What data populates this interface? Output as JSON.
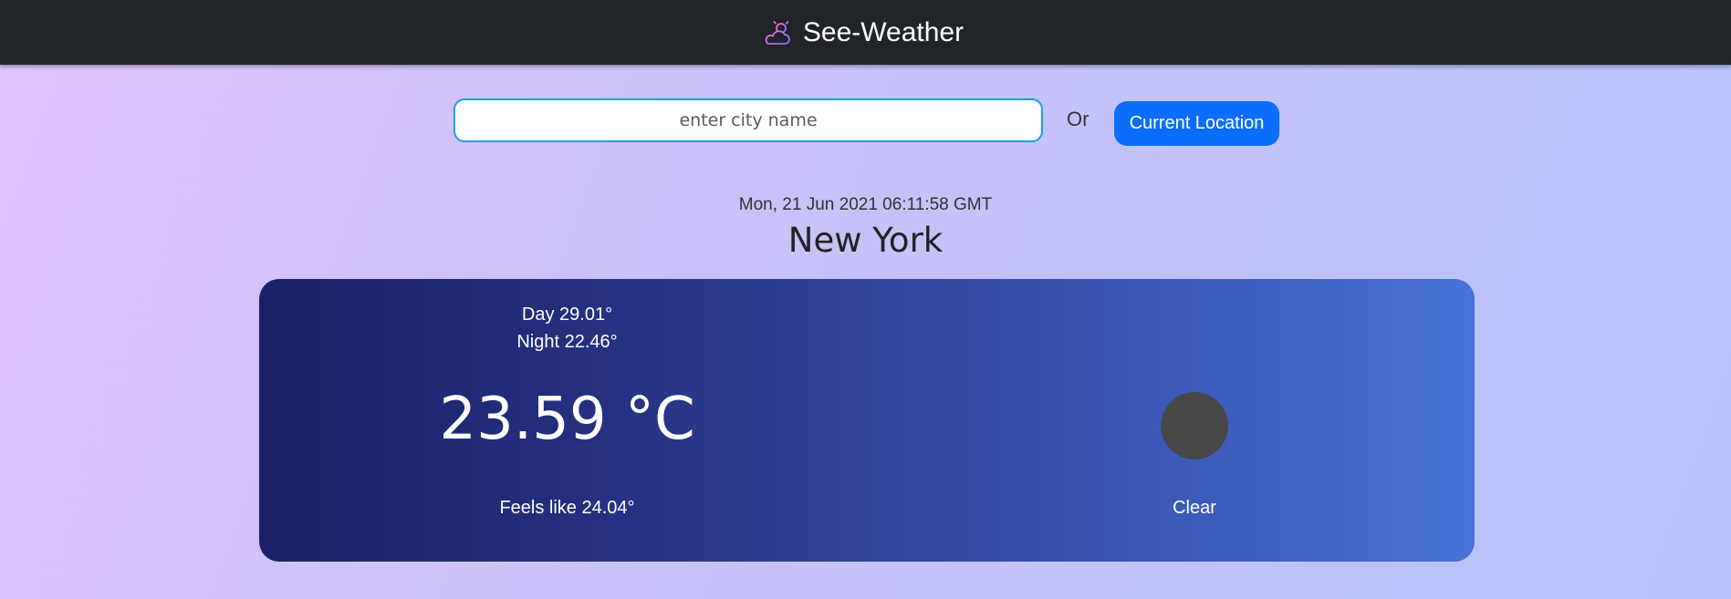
{
  "app": {
    "title": "See-Weather",
    "icon": "partly-cloudy-sun-icon"
  },
  "search": {
    "placeholder": "enter city name",
    "value": "",
    "or_label": "Or",
    "location_button_label": "Current Location"
  },
  "weather": {
    "datetime": "Mon, 21 Jun 2021 06:11:58 GMT",
    "city": "New York",
    "day_temp": "Day 29.01°",
    "night_temp": "Night 22.46°",
    "current_temp": "23.59 °C",
    "feels_like": "Feels like 24.04°",
    "condition": "Clear",
    "condition_icon": "clear-weather-icon"
  },
  "colors": {
    "navbar": "#212529",
    "button": "#0d6efd",
    "card_start": "#1c2167",
    "card_end": "#4872d8"
  }
}
